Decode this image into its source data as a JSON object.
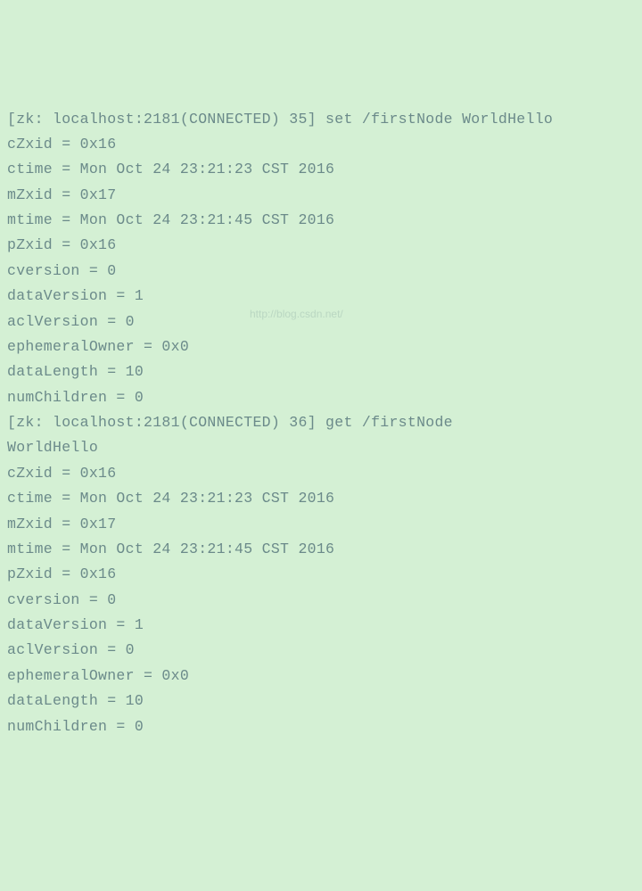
{
  "lines": [
    "[zk: localhost:2181(CONNECTED) 35] set /firstNode WorldHello",
    "cZxid = 0x16",
    "ctime = Mon Oct 24 23:21:23 CST 2016",
    "mZxid = 0x17",
    "mtime = Mon Oct 24 23:21:45 CST 2016",
    "pZxid = 0x16",
    "cversion = 0",
    "dataVersion = 1",
    "aclVersion = 0",
    "ephemeralOwner = 0x0",
    "dataLength = 10",
    "numChildren = 0",
    "[zk: localhost:2181(CONNECTED) 36] get /firstNode",
    "WorldHello",
    "cZxid = 0x16",
    "ctime = Mon Oct 24 23:21:23 CST 2016",
    "mZxid = 0x17",
    "mtime = Mon Oct 24 23:21:45 CST 2016",
    "pZxid = 0x16",
    "cversion = 0",
    "dataVersion = 1",
    "aclVersion = 0",
    "ephemeralOwner = 0x0",
    "dataLength = 10",
    "numChildren = 0"
  ],
  "watermark": "http://blog.csdn.net/"
}
